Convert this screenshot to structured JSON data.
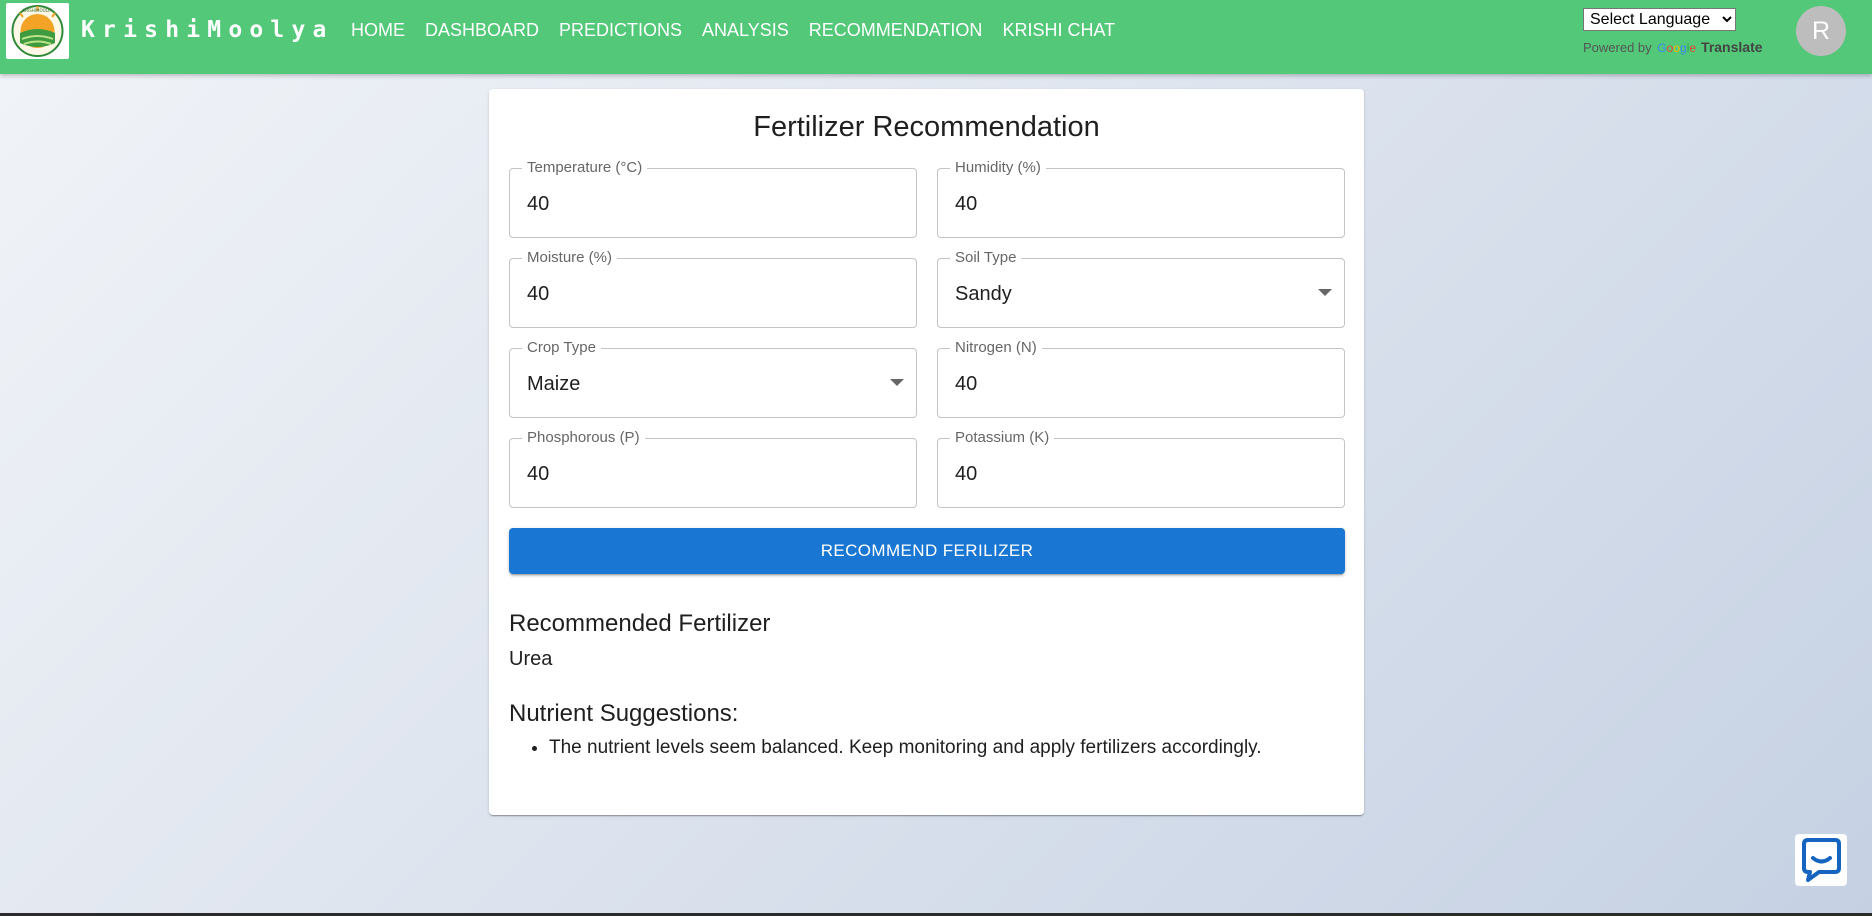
{
  "header": {
    "brand": "KrishiMoolya",
    "logo_text": "KRISHIMOOLYA",
    "nav": [
      "HOME",
      "DASHBOARD",
      "PREDICTIONS",
      "ANALYSIS",
      "RECOMMENDATION",
      "KRISHI CHAT"
    ],
    "language_select": "Select Language",
    "powered_by": "Powered by",
    "google_word": "Google",
    "translate_label": "Translate",
    "avatar_initial": "R",
    "bar_color": "#52c878"
  },
  "form": {
    "title": "Fertilizer Recommendation",
    "fields": [
      {
        "label": "Temperature (°C)",
        "value": "40",
        "kind": "input"
      },
      {
        "label": "Humidity (%)",
        "value": "40",
        "kind": "input"
      },
      {
        "label": "Moisture (%)",
        "value": "40",
        "kind": "input"
      },
      {
        "label": "Soil Type",
        "value": "Sandy",
        "kind": "select"
      },
      {
        "label": "Crop Type",
        "value": "Maize",
        "kind": "select"
      },
      {
        "label": "Nitrogen (N)",
        "value": "40",
        "kind": "input"
      },
      {
        "label": "Phosphorous (P)",
        "value": "40",
        "kind": "input"
      },
      {
        "label": "Potassium (K)",
        "value": "40",
        "kind": "input"
      }
    ],
    "submit_label": "RECOMMEND FERILIZER",
    "button_color": "#1976d2"
  },
  "result": {
    "heading": "Recommended Fertilizer",
    "value": "Urea",
    "nutrient_heading": "Nutrient Suggestions:",
    "suggestions": [
      "The nutrient levels seem balanced. Keep monitoring and apply fertilizers accordingly."
    ]
  },
  "icons": {
    "logo": "krishimoolya-logo-icon",
    "dropdown": "caret-down-icon",
    "chat": "chat-bubble-icon"
  }
}
